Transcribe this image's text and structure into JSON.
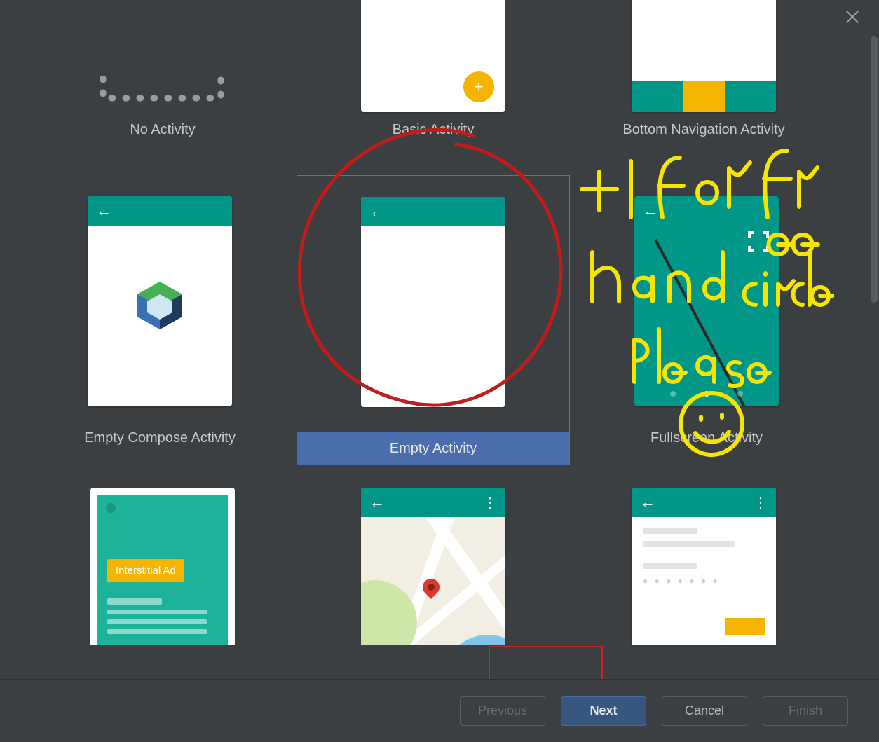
{
  "close_tooltip": "Close",
  "templates": {
    "row1": [
      {
        "id": "no-activity",
        "label": "No Activity"
      },
      {
        "id": "basic-activity",
        "label": "Basic Activity"
      },
      {
        "id": "bottom-nav-activity",
        "label": "Bottom Navigation Activity"
      }
    ],
    "row2": [
      {
        "id": "empty-compose",
        "label": "Empty Compose Activity",
        "selected": false
      },
      {
        "id": "empty-activity",
        "label": "Empty Activity",
        "selected": true
      },
      {
        "id": "fullscreen-activity",
        "label": "Fullscreen Activity",
        "selected": false
      }
    ],
    "row3_ads_badge": "Interstitial Ad"
  },
  "buttons": {
    "previous": "Previous",
    "next": "Next",
    "cancel": "Cancel",
    "finish": "Finish"
  },
  "annotation": {
    "handwriting_text": "+1 for free hand circle please",
    "color": "#f6e500",
    "circle_color": "#c11b1b"
  }
}
